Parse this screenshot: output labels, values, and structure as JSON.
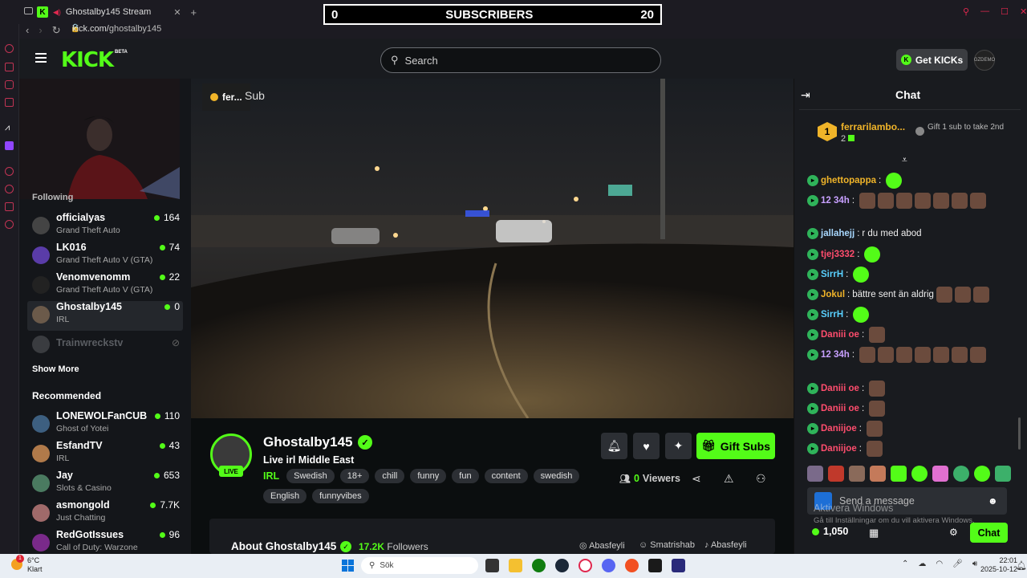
{
  "browser": {
    "tab_title": "Ghostalby145 Stream",
    "url_host": "kick.com/",
    "url_path": "ghostalby145"
  },
  "overlay": {
    "sub_left": "0",
    "sub_label": "SUBSCRIBERS",
    "sub_right": "20"
  },
  "header": {
    "logo": "KICK",
    "beta": "BETA",
    "search_placeholder": "Search",
    "get_kicks": "Get KICKs",
    "avatar_text": "GZDEMO"
  },
  "sidebar": {
    "following_heading": "Following",
    "following": [
      {
        "name": "officialyas",
        "category": "Grand Theft Auto",
        "viewers": "164",
        "color": "#444"
      },
      {
        "name": "LK016",
        "category": "Grand Theft Auto V (GTA)",
        "viewers": "74",
        "color": "#5a3ca8"
      },
      {
        "name": "Venomvenomm",
        "category": "Grand Theft Auto V (GTA)",
        "viewers": "22",
        "color": "#222"
      },
      {
        "name": "Ghostalby145",
        "category": "IRL",
        "viewers": "0",
        "color": "#6b5a4a"
      }
    ],
    "offline": {
      "name": "Trainwreckstv"
    },
    "show_more": "Show More",
    "recommended_heading": "Recommended",
    "recommended": [
      {
        "name": "LONEWOLFanCUB",
        "category": "Ghost of Yotei",
        "viewers": "110",
        "color": "#3d5f80"
      },
      {
        "name": "EsfandTV",
        "category": "IRL",
        "viewers": "43",
        "color": "#b07a4a"
      },
      {
        "name": "Jay",
        "category": "Slots & Casino",
        "viewers": "653",
        "color": "#4a7a60"
      },
      {
        "name": "asmongold",
        "category": "Just Chatting",
        "viewers": "7.7K",
        "color": "#a06a6a"
      },
      {
        "name": "RedGotIssues",
        "category": "Call of Duty: Warzone",
        "viewers": "96",
        "color": "#7a2a8a"
      }
    ]
  },
  "video": {
    "chip_text": "fer...",
    "overlay_text": "Sub"
  },
  "stream": {
    "streamer": "Ghostalby145",
    "live": "LIVE",
    "title": "Live irl Middle East",
    "category": "IRL",
    "tags": [
      "Swedish",
      "18+",
      "chill",
      "funny",
      "fun",
      "content",
      "swedish"
    ],
    "tags2": [
      "English",
      "funnyvibes"
    ],
    "gift_subs": "Gift Subs",
    "viewers": "0",
    "viewers_label": "Viewers",
    "about": "About Ghostalby145",
    "followers": "17.2K",
    "followers_label": "Followers",
    "socials": [
      "Abasfeyli",
      "Smatrishab",
      "Abasfeyli"
    ]
  },
  "chat": {
    "title": "Chat",
    "pinned": {
      "rank": "1",
      "name": "ferrarilambo...",
      "count": "2",
      "note": "Gift 1 sub to take 2nd"
    },
    "messages": [
      {
        "user": "ghettopappa",
        "color": "#f0b429",
        "text": ""
      },
      {
        "user": "12 34h",
        "color": "#c8a0ff",
        "text": ""
      },
      {
        "user": "jallahejj",
        "color": "#a8d8ff",
        "text": "r du med abod"
      },
      {
        "user": "tjej3332",
        "color": "#ff4d6d",
        "text": ""
      },
      {
        "user": "SirrH",
        "color": "#59d0ff",
        "text": ""
      },
      {
        "user": "Jokul",
        "color": "#f0b429",
        "text": "bättre sent än aldrig"
      },
      {
        "user": "SirrH",
        "color": "#59d0ff",
        "text": ""
      },
      {
        "user": "Daniii oe",
        "color": "#ff4d6d",
        "text": ""
      },
      {
        "user": "12 34h",
        "color": "#c8a0ff",
        "text": ""
      },
      {
        "user": "Daniii oe",
        "color": "#ff4d6d",
        "text": ""
      },
      {
        "user": "Daniii oe",
        "color": "#ff4d6d",
        "text": ""
      },
      {
        "user": "Daniijoe",
        "color": "#ff4d6d",
        "text": ""
      },
      {
        "user": "Daniijoe",
        "color": "#ff4d6d",
        "text": ""
      }
    ],
    "input_placeholder": "Send a message",
    "kicks": "1,050",
    "send": "Chat"
  },
  "watermark": {
    "line1": "Aktivera Windows",
    "line2": "Gå till Inställningar om du vill aktivera Windows."
  },
  "taskbar": {
    "temp": "6°C",
    "weather": "Klart",
    "weather_badge": "1",
    "search": "Sök",
    "time": "22:01",
    "date": "2025-10-12"
  }
}
